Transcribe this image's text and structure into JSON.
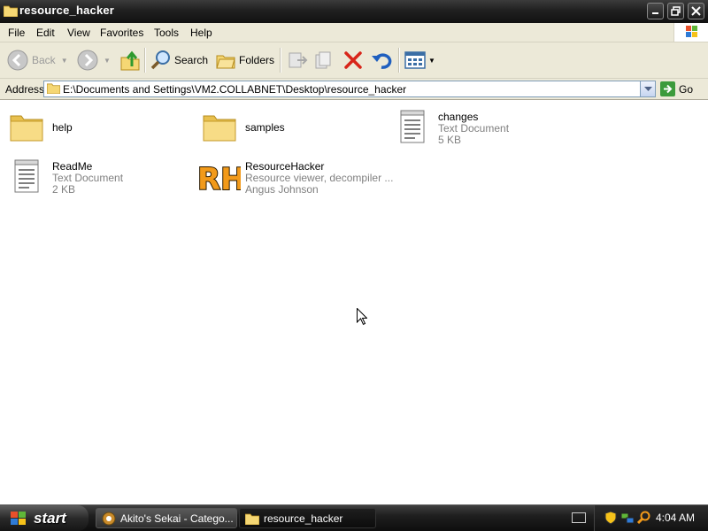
{
  "window": {
    "title": "resource_hacker"
  },
  "menu": [
    "File",
    "Edit",
    "View",
    "Favorites",
    "Tools",
    "Help"
  ],
  "toolbar": {
    "back_label": "Back",
    "search_label": "Search",
    "folders_label": "Folders"
  },
  "address": {
    "label": "Address",
    "path": "E:\\Documents and Settings\\VM2.COLLABNET\\Desktop\\resource_hacker",
    "go_label": "Go"
  },
  "files": [
    {
      "name": "help",
      "type": "folder"
    },
    {
      "name": "samples",
      "type": "folder"
    },
    {
      "name": "changes",
      "line2": "Text Document",
      "line3": "5 KB",
      "type": "text"
    },
    {
      "name": "ReadMe",
      "line2": "Text Document",
      "line3": "2 KB",
      "type": "text"
    },
    {
      "name": "ResourceHacker",
      "line2": "Resource viewer, decompiler ...",
      "line3": "Angus Johnson",
      "type": "app"
    }
  ],
  "taskbar": {
    "start_label": "start",
    "tasks": [
      "Akito's Sekai - Catego...",
      "resource_hacker"
    ],
    "clock": "4:04 AM"
  },
  "colors": {
    "folder": "#f5d774",
    "rh_orange": "#f29a1a",
    "go_green": "#3c9b3c"
  }
}
